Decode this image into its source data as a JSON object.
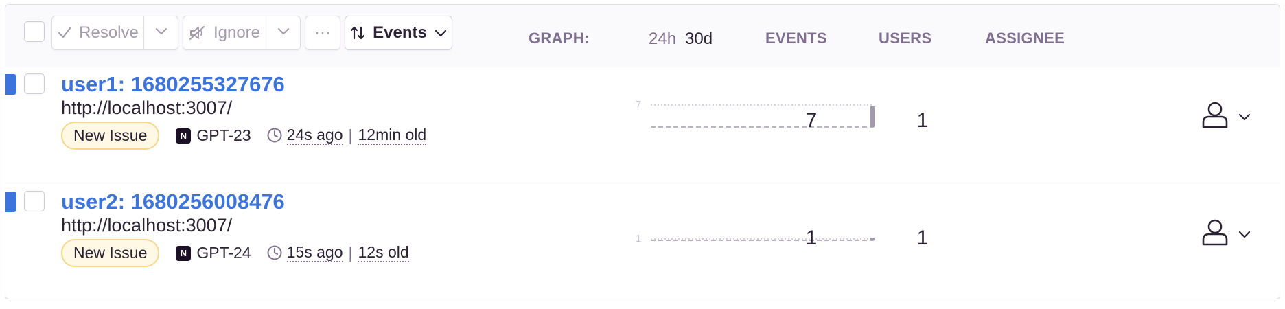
{
  "toolbar": {
    "resolve_label": "Resolve",
    "ignore_label": "Ignore",
    "more_label": "···",
    "sort_label": "Events"
  },
  "columns": {
    "graph_label": "GRAPH:",
    "range_24h": "24h",
    "range_30d": "30d",
    "active_range": "30d",
    "events_label": "EVENTS",
    "users_label": "USERS",
    "assignee_label": "ASSIGNEE"
  },
  "issues": [
    {
      "title": "user1: 1680255327676",
      "url": "http://localhost:3007/",
      "badge": "New Issue",
      "project_short": "GPT-23",
      "last_seen": "24s ago",
      "age": "12min old",
      "graph_max_label": "7",
      "events": "7",
      "users": "1"
    },
    {
      "title": "user2: 1680256008476",
      "url": "http://localhost:3007/",
      "badge": "New Issue",
      "project_short": "GPT-24",
      "last_seen": "15s ago",
      "age": "12s old",
      "graph_max_label": "1",
      "events": "1",
      "users": "1"
    }
  ],
  "separator": "|",
  "colors": {
    "accent": "#3d74db",
    "badge_border": "#f5d88c",
    "badge_bg": "#fff8e5",
    "muted": "#80708f",
    "border": "#e0dce5"
  },
  "icons": [
    "checkmark-icon",
    "chevron-down-icon",
    "mute-icon",
    "sort-icon",
    "clock-icon",
    "user-icon",
    "project-platform-icon"
  ]
}
